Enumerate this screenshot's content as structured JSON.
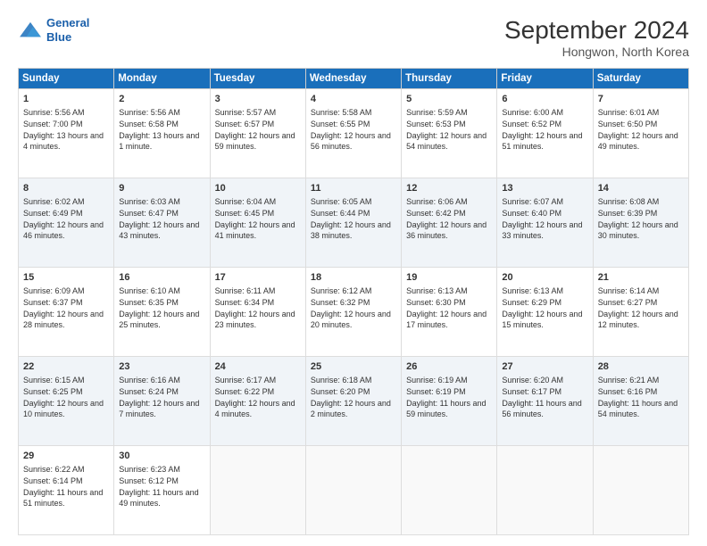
{
  "logo": {
    "line1": "General",
    "line2": "Blue"
  },
  "title": "September 2024",
  "subtitle": "Hongwon, North Korea",
  "headers": [
    "Sunday",
    "Monday",
    "Tuesday",
    "Wednesday",
    "Thursday",
    "Friday",
    "Saturday"
  ],
  "weeks": [
    [
      {
        "day": "1",
        "sunrise": "5:56 AM",
        "sunset": "7:00 PM",
        "daylight": "13 hours and 4 minutes."
      },
      {
        "day": "2",
        "sunrise": "5:56 AM",
        "sunset": "6:58 PM",
        "daylight": "13 hours and 1 minute."
      },
      {
        "day": "3",
        "sunrise": "5:57 AM",
        "sunset": "6:57 PM",
        "daylight": "12 hours and 59 minutes."
      },
      {
        "day": "4",
        "sunrise": "5:58 AM",
        "sunset": "6:55 PM",
        "daylight": "12 hours and 56 minutes."
      },
      {
        "day": "5",
        "sunrise": "5:59 AM",
        "sunset": "6:53 PM",
        "daylight": "12 hours and 54 minutes."
      },
      {
        "day": "6",
        "sunrise": "6:00 AM",
        "sunset": "6:52 PM",
        "daylight": "12 hours and 51 minutes."
      },
      {
        "day": "7",
        "sunrise": "6:01 AM",
        "sunset": "6:50 PM",
        "daylight": "12 hours and 49 minutes."
      }
    ],
    [
      {
        "day": "8",
        "sunrise": "6:02 AM",
        "sunset": "6:49 PM",
        "daylight": "12 hours and 46 minutes."
      },
      {
        "day": "9",
        "sunrise": "6:03 AM",
        "sunset": "6:47 PM",
        "daylight": "12 hours and 43 minutes."
      },
      {
        "day": "10",
        "sunrise": "6:04 AM",
        "sunset": "6:45 PM",
        "daylight": "12 hours and 41 minutes."
      },
      {
        "day": "11",
        "sunrise": "6:05 AM",
        "sunset": "6:44 PM",
        "daylight": "12 hours and 38 minutes."
      },
      {
        "day": "12",
        "sunrise": "6:06 AM",
        "sunset": "6:42 PM",
        "daylight": "12 hours and 36 minutes."
      },
      {
        "day": "13",
        "sunrise": "6:07 AM",
        "sunset": "6:40 PM",
        "daylight": "12 hours and 33 minutes."
      },
      {
        "day": "14",
        "sunrise": "6:08 AM",
        "sunset": "6:39 PM",
        "daylight": "12 hours and 30 minutes."
      }
    ],
    [
      {
        "day": "15",
        "sunrise": "6:09 AM",
        "sunset": "6:37 PM",
        "daylight": "12 hours and 28 minutes."
      },
      {
        "day": "16",
        "sunrise": "6:10 AM",
        "sunset": "6:35 PM",
        "daylight": "12 hours and 25 minutes."
      },
      {
        "day": "17",
        "sunrise": "6:11 AM",
        "sunset": "6:34 PM",
        "daylight": "12 hours and 23 minutes."
      },
      {
        "day": "18",
        "sunrise": "6:12 AM",
        "sunset": "6:32 PM",
        "daylight": "12 hours and 20 minutes."
      },
      {
        "day": "19",
        "sunrise": "6:13 AM",
        "sunset": "6:30 PM",
        "daylight": "12 hours and 17 minutes."
      },
      {
        "day": "20",
        "sunrise": "6:13 AM",
        "sunset": "6:29 PM",
        "daylight": "12 hours and 15 minutes."
      },
      {
        "day": "21",
        "sunrise": "6:14 AM",
        "sunset": "6:27 PM",
        "daylight": "12 hours and 12 minutes."
      }
    ],
    [
      {
        "day": "22",
        "sunrise": "6:15 AM",
        "sunset": "6:25 PM",
        "daylight": "12 hours and 10 minutes."
      },
      {
        "day": "23",
        "sunrise": "6:16 AM",
        "sunset": "6:24 PM",
        "daylight": "12 hours and 7 minutes."
      },
      {
        "day": "24",
        "sunrise": "6:17 AM",
        "sunset": "6:22 PM",
        "daylight": "12 hours and 4 minutes."
      },
      {
        "day": "25",
        "sunrise": "6:18 AM",
        "sunset": "6:20 PM",
        "daylight": "12 hours and 2 minutes."
      },
      {
        "day": "26",
        "sunrise": "6:19 AM",
        "sunset": "6:19 PM",
        "daylight": "11 hours and 59 minutes."
      },
      {
        "day": "27",
        "sunrise": "6:20 AM",
        "sunset": "6:17 PM",
        "daylight": "11 hours and 56 minutes."
      },
      {
        "day": "28",
        "sunrise": "6:21 AM",
        "sunset": "6:16 PM",
        "daylight": "11 hours and 54 minutes."
      }
    ],
    [
      {
        "day": "29",
        "sunrise": "6:22 AM",
        "sunset": "6:14 PM",
        "daylight": "11 hours and 51 minutes."
      },
      {
        "day": "30",
        "sunrise": "6:23 AM",
        "sunset": "6:12 PM",
        "daylight": "11 hours and 49 minutes."
      },
      null,
      null,
      null,
      null,
      null
    ]
  ],
  "labels": {
    "sunrise": "Sunrise:",
    "sunset": "Sunset:",
    "daylight": "Daylight:"
  }
}
